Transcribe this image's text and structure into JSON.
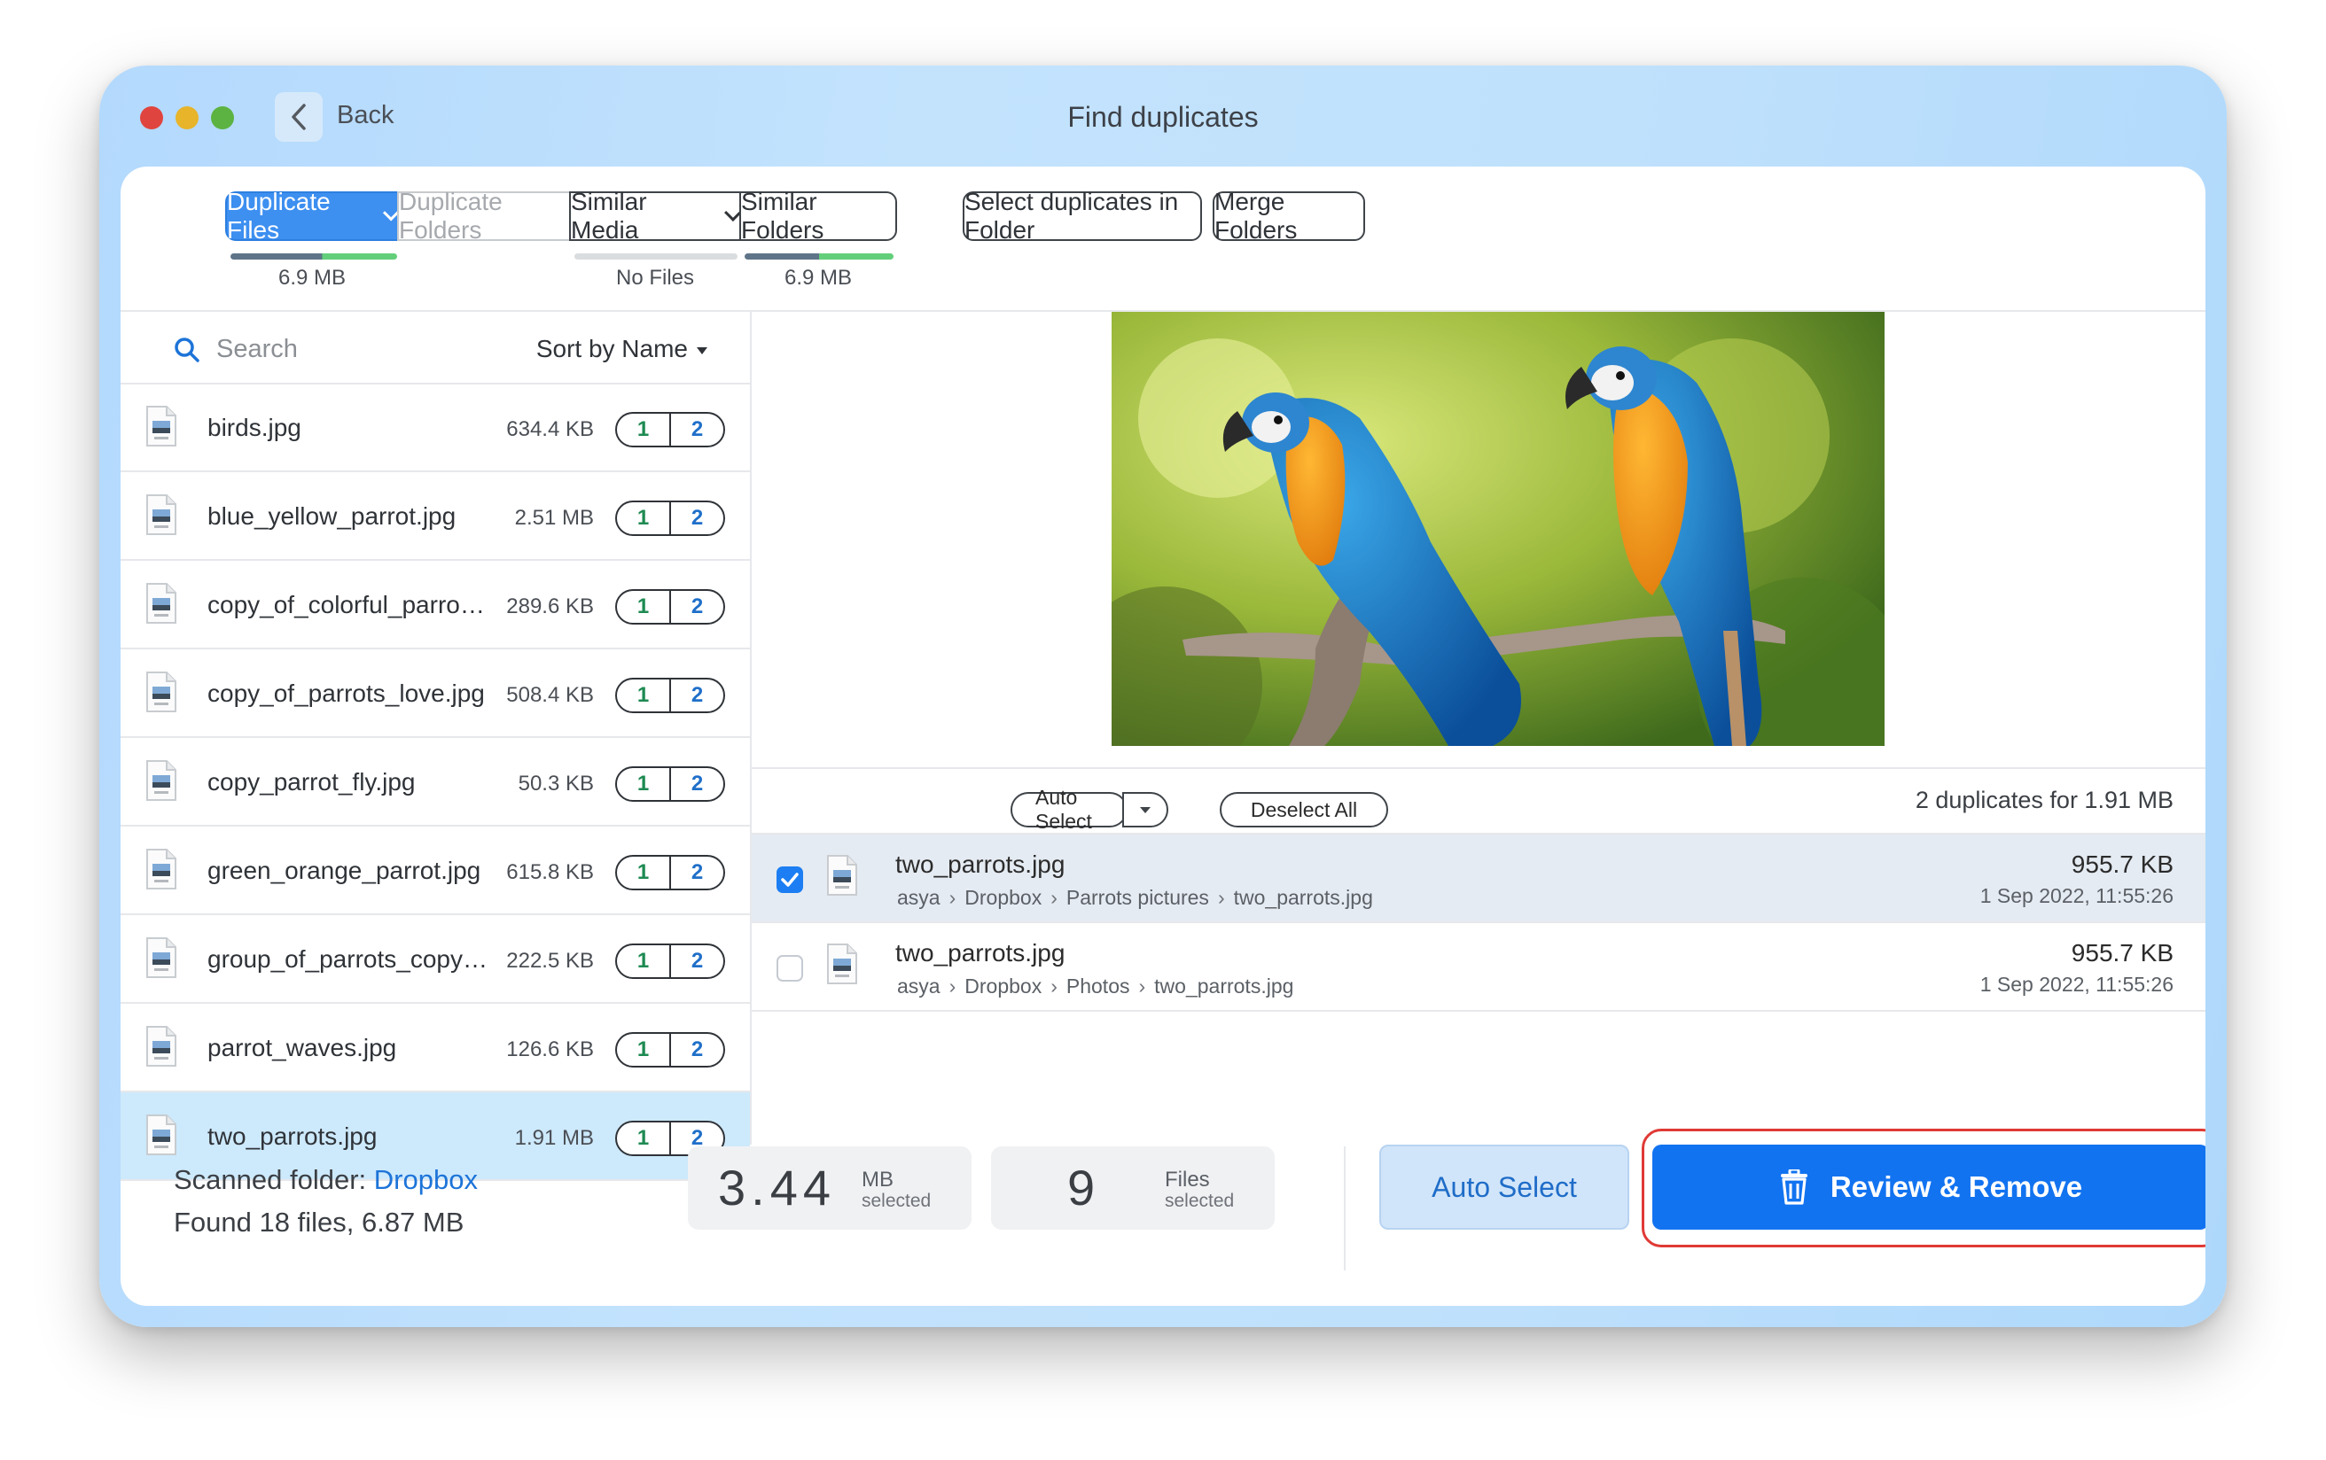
{
  "window": {
    "title": "Find duplicates",
    "back_label": "Back"
  },
  "tabs": [
    {
      "label": "Duplicate Files",
      "size": "6.9 MB"
    },
    {
      "label": "Duplicate Folders"
    },
    {
      "label": "Similar Media",
      "size": "No Files"
    },
    {
      "label": "Similar Folders",
      "size": "6.9 MB"
    }
  ],
  "actions": {
    "select_in_folder": "Select duplicates in Folder",
    "merge_folders": "Merge Folders"
  },
  "search": {
    "placeholder": "Search",
    "sort_label": "Sort by Name"
  },
  "files": [
    {
      "name": "birds.jpg",
      "size": "634.4 KB",
      "a": "1",
      "b": "2"
    },
    {
      "name": "blue_yellow_parrot.jpg",
      "size": "2.51 MB",
      "a": "1",
      "b": "2"
    },
    {
      "name": "copy_of_colorful_parro…",
      "size": "289.6 KB",
      "a": "1",
      "b": "2"
    },
    {
      "name": "copy_of_parrots_love.jpg",
      "size": "508.4 KB",
      "a": "1",
      "b": "2"
    },
    {
      "name": "copy_parrot_fly.jpg",
      "size": "50.3 KB",
      "a": "1",
      "b": "2"
    },
    {
      "name": "green_orange_parrot.jpg",
      "size": "615.8 KB",
      "a": "1",
      "b": "2"
    },
    {
      "name": "group_of_parrots_copy…",
      "size": "222.5 KB",
      "a": "1",
      "b": "2"
    },
    {
      "name": "parrot_waves.jpg",
      "size": "126.6 KB",
      "a": "1",
      "b": "2"
    },
    {
      "name": "two_parrots.jpg",
      "size": "1.91 MB",
      "a": "1",
      "b": "2"
    }
  ],
  "controls": {
    "auto_select": "Auto Select",
    "deselect_all": "Deselect All",
    "summary": "2 duplicates for 1.91 MB"
  },
  "duplicates": [
    {
      "name": "two_parrots.jpg",
      "path": [
        "asya",
        "Dropbox",
        "Parrots pictures",
        "two_parrots.jpg"
      ],
      "size": "955.7 KB",
      "date": "1 Sep 2022, 11:55:26",
      "checked": true
    },
    {
      "name": "two_parrots.jpg",
      "path": [
        "asya",
        "Dropbox",
        "Photos",
        "two_parrots.jpg"
      ],
      "size": "955.7 KB",
      "date": "1 Sep 2022, 11:55:26",
      "checked": false
    }
  ],
  "footer": {
    "scanned_prefix": "Scanned folder:",
    "scanned_folder": "Dropbox",
    "found": "Found 18 files, 6.87 MB",
    "selected_size": "3.44",
    "selected_size_unit": "MB",
    "selected_size_sub": "selected",
    "selected_count": "9",
    "selected_count_unit": "Files",
    "selected_count_sub": "selected",
    "auto_select": "Auto Select",
    "review_remove": "Review & Remove"
  },
  "colors": {
    "accent": "#1273f0",
    "tab_active": "#3d8ff0",
    "highlight": "#e03a36",
    "count_green": "#1e8a52",
    "count_blue": "#1f6fc9"
  }
}
